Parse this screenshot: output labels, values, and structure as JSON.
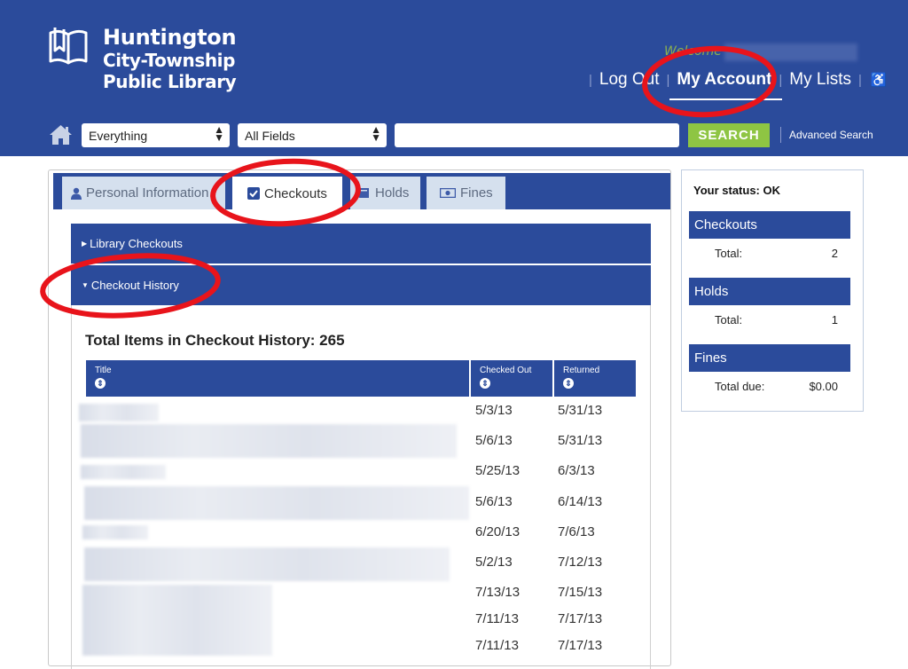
{
  "header": {
    "logo_line1": "Huntington",
    "logo_line2": "City-Township",
    "logo_line3": "Public Library",
    "welcome": "Welcome",
    "nav": {
      "logout": "Log Out",
      "my_account": "My Account",
      "my_lists": "My Lists"
    },
    "search": {
      "scope": "Everything",
      "field": "All Fields",
      "query": "",
      "button": "SEARCH",
      "advanced": "Advanced Search"
    }
  },
  "tabs": {
    "personal": "Personal Information",
    "checkouts": "Checkouts",
    "holds": "Holds",
    "fines": "Fines"
  },
  "sections": {
    "library_checkouts": "Library Checkouts",
    "checkout_history": "Checkout History"
  },
  "history": {
    "title": "Total Items in Checkout History: 265",
    "columns": {
      "title": "Title",
      "checked_out": "Checked Out",
      "returned": "Returned"
    },
    "rows": [
      {
        "checked_out": "5/3/13",
        "returned": "5/31/13"
      },
      {
        "checked_out": "5/6/13",
        "returned": "5/31/13"
      },
      {
        "checked_out": "5/25/13",
        "returned": "6/3/13"
      },
      {
        "checked_out": "5/6/13",
        "returned": "6/14/13"
      },
      {
        "checked_out": "6/20/13",
        "returned": "7/6/13"
      },
      {
        "checked_out": "5/2/13",
        "returned": "7/12/13"
      },
      {
        "checked_out": "7/13/13",
        "returned": "7/15/13"
      },
      {
        "checked_out": "7/11/13",
        "returned": "7/17/13"
      },
      {
        "checked_out": "7/11/13",
        "returned": "7/17/13"
      }
    ]
  },
  "sidebar": {
    "status": "Your status: OK",
    "checkouts": {
      "heading": "Checkouts",
      "label": "Total:",
      "value": "2"
    },
    "holds": {
      "heading": "Holds",
      "label": "Total:",
      "value": "1"
    },
    "fines": {
      "heading": "Fines",
      "label": "Total due:",
      "value": "$0.00"
    }
  },
  "colors": {
    "brand_blue": "#2b4b9b",
    "search_green": "#8ec543",
    "tab_inactive": "#d5e0ee",
    "annotation_red": "#e8141b"
  },
  "icons": {
    "logo": "open-book-icon",
    "home": "home-icon",
    "accessibility": "wheelchair-icon",
    "personal": "person-icon",
    "checkouts": "checkbox-icon",
    "holds": "book-icon",
    "fines": "money-icon",
    "sort": "sort-icon"
  }
}
